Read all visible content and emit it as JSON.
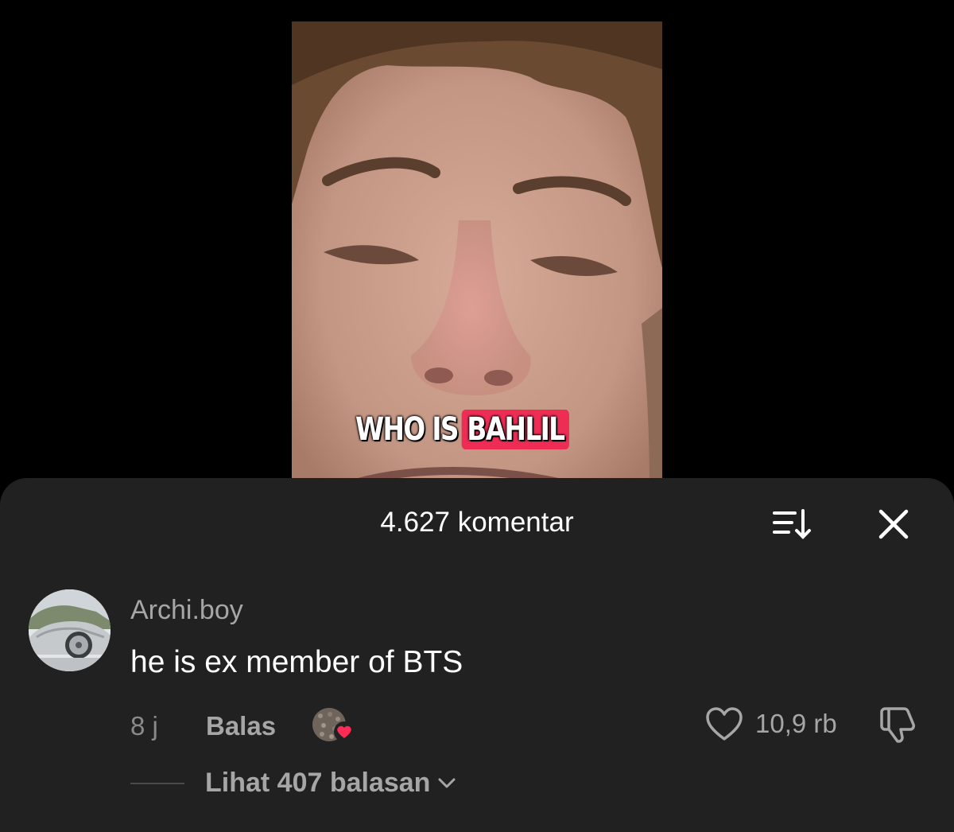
{
  "video": {
    "caption_white": "WHO IS",
    "caption_highlight": "BAHLIL",
    "highlight_color": "#ee2d55"
  },
  "comments_panel": {
    "title": "4.627 komentar",
    "sort_icon": "sort-icon",
    "close_icon": "close-icon",
    "background": "#212121"
  },
  "comment": {
    "username": "Archi.boy",
    "text": "he is ex member of BTS",
    "time": "8 j",
    "reply_label": "Balas",
    "like_count": "10,9 rb",
    "view_replies_label": "Lihat 407 balasan",
    "creator_liked": true,
    "icons": {
      "like": "heart-outline-icon",
      "dislike": "thumbs-down-icon",
      "chevron": "chevron-down-icon",
      "creator_heart": "heart-filled-icon"
    }
  }
}
